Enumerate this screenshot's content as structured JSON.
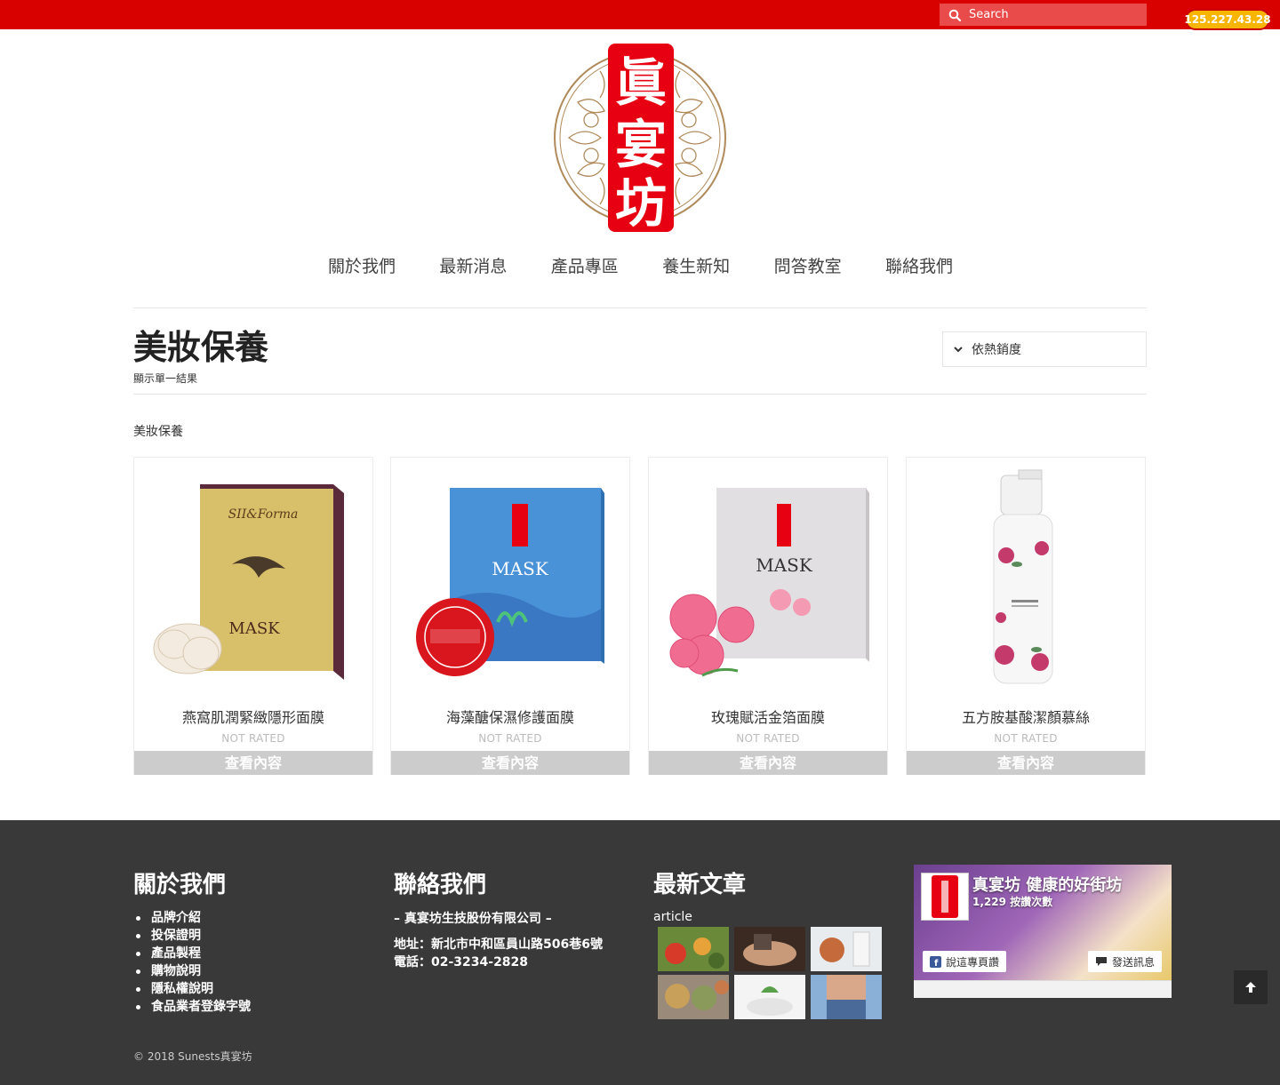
{
  "header": {
    "search_placeholder": "Search",
    "ip_badge": "125.227.43.28"
  },
  "logo": {
    "alt": "真宴坊",
    "chars": [
      "眞",
      "宴",
      "坊"
    ]
  },
  "nav": {
    "items": [
      {
        "label": "關於我們"
      },
      {
        "label": "最新消息"
      },
      {
        "label": "產品專區"
      },
      {
        "label": "養生新知"
      },
      {
        "label": "問答教室"
      },
      {
        "label": "聯絡我們"
      }
    ]
  },
  "page": {
    "title": "美妝保養",
    "result_count": "顯示單一結果",
    "sort_selected": "依熱銷度",
    "category": "美妝保養"
  },
  "products": [
    {
      "name": "燕窩肌潤緊緻隱形面膜",
      "rating": "NOT RATED",
      "button": "查看內容",
      "box_text": "MASK"
    },
    {
      "name": "海藻醣保濕修護面膜",
      "rating": "NOT RATED",
      "button": "查看內容",
      "box_text": "MASK"
    },
    {
      "name": "玫瑰賦活金箔面膜",
      "rating": "NOT RATED",
      "button": "查看內容",
      "box_text": "MASK"
    },
    {
      "name": "五方胺基酸潔顏慕絲",
      "rating": "NOT RATED",
      "button": "查看內容",
      "box_text": ""
    }
  ],
  "footer": {
    "about": {
      "title": "關於我們",
      "links": [
        "品牌介紹",
        "投保證明",
        "產品製程",
        "購物說明",
        "隱私權說明",
        "食品業者登錄字號"
      ]
    },
    "contact": {
      "title": "聯絡我們",
      "company": "– 真宴坊生技股份有限公司 –",
      "address": "地址：新北市中和區員山路506巷6號",
      "phone": "電話：02-3234-2828"
    },
    "articles": {
      "title": "最新文章",
      "label": "article"
    },
    "facebook": {
      "page_name": "真宴坊 健康的好街坊",
      "likes": "1,229 按讚次數",
      "like_button": "說這專頁讚",
      "message_button": "發送訊息"
    },
    "copyright": "© 2018 Sunests真宴坊"
  },
  "colors": {
    "brand_red": "#d90000",
    "badge": "#f7b500",
    "footer_bg": "#393939",
    "button_gray": "#cccccc"
  }
}
